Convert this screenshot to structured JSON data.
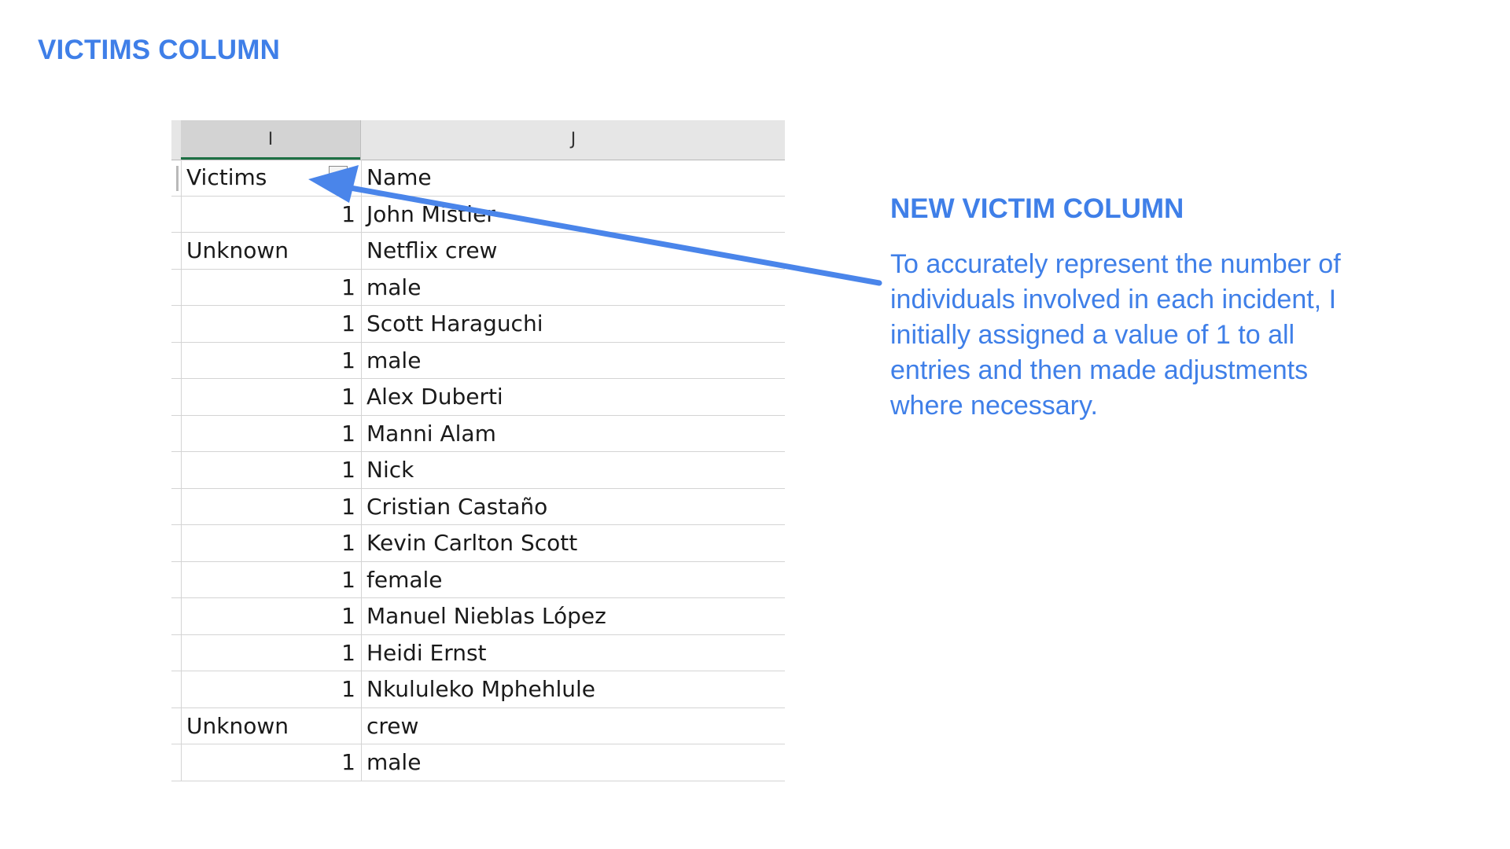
{
  "slide": {
    "title": "VICTIMS COLUMN"
  },
  "sheet": {
    "columns": [
      "I",
      "J"
    ],
    "header": {
      "victims": "Victims",
      "name": "Name"
    },
    "rows": [
      {
        "victims": "1",
        "name": "John Mistler"
      },
      {
        "victims": "Unknown",
        "name": "Netflix crew"
      },
      {
        "victims": "1",
        "name": "male"
      },
      {
        "victims": "1",
        "name": "Scott Haraguchi"
      },
      {
        "victims": "1",
        "name": "male"
      },
      {
        "victims": "1",
        "name": "Alex Duberti"
      },
      {
        "victims": "1",
        "name": "Manni Alam"
      },
      {
        "victims": "1",
        "name": "Nick"
      },
      {
        "victims": "1",
        "name": "Cristian Castaño"
      },
      {
        "victims": "1",
        "name": "Kevin  Carlton Scott"
      },
      {
        "victims": "1",
        "name": "female"
      },
      {
        "victims": "1",
        "name": "Manuel Nieblas López"
      },
      {
        "victims": "1",
        "name": "Heidi Ernst"
      },
      {
        "victims": "1",
        "name": "Nkululeko Mphehlule"
      },
      {
        "victims": "Unknown",
        "name": "crew"
      },
      {
        "victims": "1",
        "name": "male"
      }
    ]
  },
  "annotation": {
    "heading": "NEW VICTIM COLUMN",
    "body": "To accurately represent the number of individuals involved in each incident, I initially assigned a value of 1 to all entries and then made adjustments where necessary."
  },
  "colors": {
    "accent": "#3f7fe8",
    "arrow": "#4a85ea",
    "selected_column_underline": "#1d7044"
  },
  "icons": {
    "filter": "filter-dropdown-icon",
    "arrow": "arrow-left-icon"
  }
}
